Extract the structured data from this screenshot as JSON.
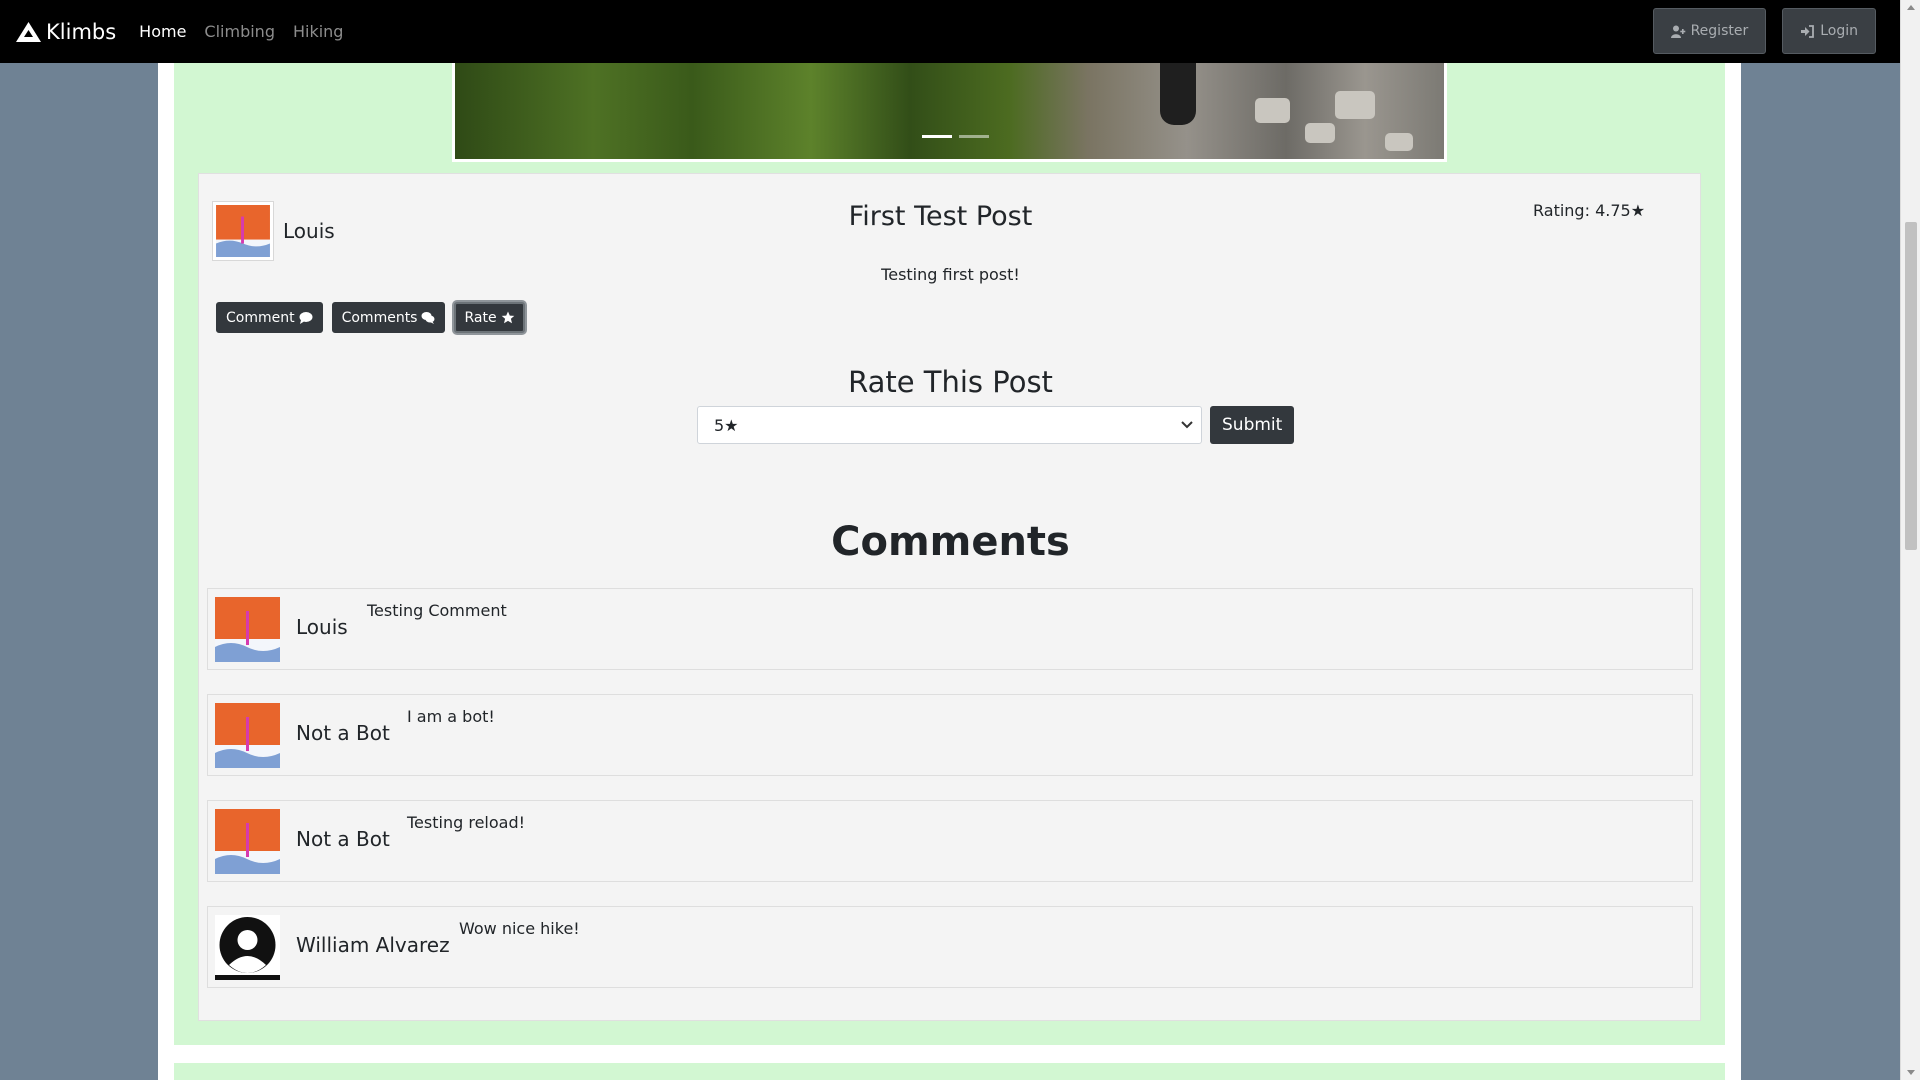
{
  "navbar": {
    "brand": "Klimbs",
    "links": [
      "Home",
      "Climbing",
      "Hiking"
    ],
    "register": "Register",
    "login": "Login"
  },
  "post": {
    "author": "Louis",
    "title": "First Test Post",
    "rating": "Rating: 4.75★",
    "body": "Testing first post!",
    "actions": {
      "comment": "Comment",
      "comments": "Comments",
      "rate": "Rate"
    }
  },
  "rate_form": {
    "title": "Rate This Post",
    "selected": "5★",
    "submit": "Submit"
  },
  "comments": {
    "title": "Comments",
    "items": [
      {
        "name": "Louis",
        "text": "Testing Comment",
        "avatar": "climber-avatar"
      },
      {
        "name": "Not a Bot",
        "text": "I am a bot!",
        "avatar": "climber-avatar"
      },
      {
        "name": "Not a Bot",
        "text": "Testing reload!",
        "avatar": "climber-avatar"
      },
      {
        "name": "William Alvarez",
        "text": "Wow nice hike!",
        "avatar": "default-user-avatar"
      }
    ]
  },
  "colors": {
    "navbar": "#000000",
    "page_background": "#6f8294",
    "card_green": "#d2f7d2",
    "button_dark": "#33383d"
  }
}
